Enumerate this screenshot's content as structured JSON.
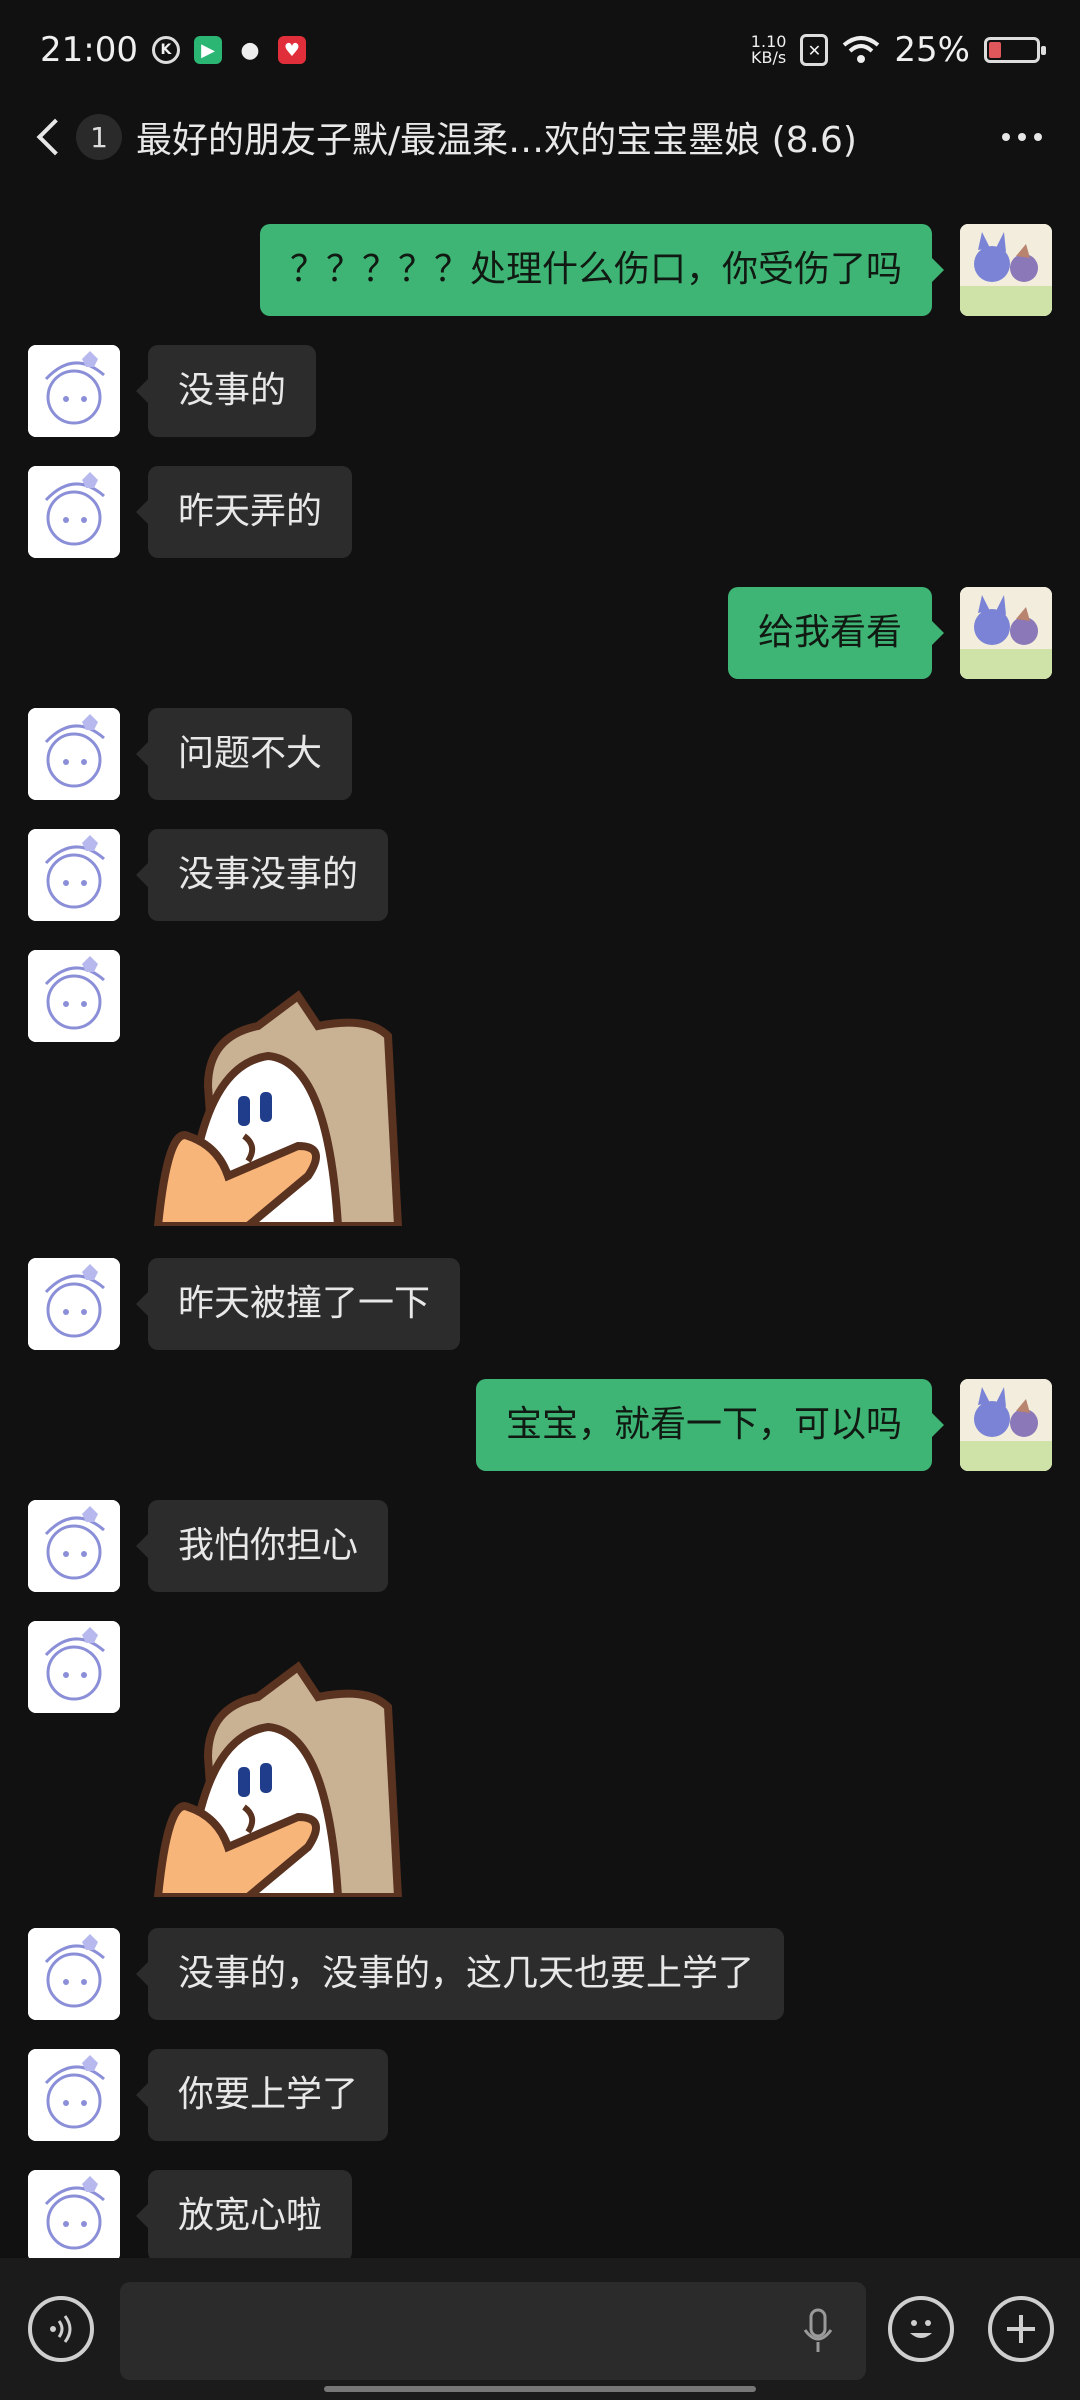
{
  "status_bar": {
    "time": "21:00",
    "net_speed_value": "1.10",
    "net_speed_unit": "KB/s",
    "battery_percent": "25%",
    "battery_level": 0.25,
    "left_icons": [
      "k-circle-icon",
      "video-app-icon",
      "wechat-icon",
      "red-app-icon"
    ],
    "right_icons": [
      "sim-off-icon",
      "wifi-icon",
      "battery-icon"
    ]
  },
  "header": {
    "unread_count": "1",
    "title": "最好的朋友子默/最温柔…欢的宝宝墨娘 (8.6)"
  },
  "messages": [
    {
      "side": "right",
      "type": "text",
      "text": "？？？？？处理什么伤口，你受伤了吗"
    },
    {
      "side": "left",
      "type": "text",
      "text": "没事的"
    },
    {
      "side": "left",
      "type": "text",
      "text": "昨天弄的"
    },
    {
      "side": "right",
      "type": "text",
      "text": "给我看看"
    },
    {
      "side": "left",
      "type": "text",
      "text": "问题不大"
    },
    {
      "side": "left",
      "type": "text",
      "text": "没事没事的"
    },
    {
      "side": "left",
      "type": "sticker",
      "text": "cat-hug-sticker"
    },
    {
      "side": "left",
      "type": "text",
      "text": "昨天被撞了一下"
    },
    {
      "side": "right",
      "type": "text",
      "text": "宝宝，就看一下，可以吗"
    },
    {
      "side": "left",
      "type": "text",
      "text": "我怕你担心"
    },
    {
      "side": "left",
      "type": "sticker",
      "text": "cat-hug-sticker"
    },
    {
      "side": "left",
      "type": "text",
      "text": "没事的，没事的，这几天也要上学了"
    },
    {
      "side": "left",
      "type": "text",
      "text": "你要上学了"
    },
    {
      "side": "left",
      "type": "text",
      "text": "放宽心啦"
    }
  ],
  "input_bar": {
    "placeholder": "",
    "icons": [
      "voice-icon",
      "microphone-icon",
      "emoji-icon",
      "plus-icon"
    ]
  },
  "colors": {
    "background": "#111111",
    "bubble_self": "#3eb575",
    "bubble_other": "#2c2c2c",
    "input_bar": "#1b1b1b"
  }
}
